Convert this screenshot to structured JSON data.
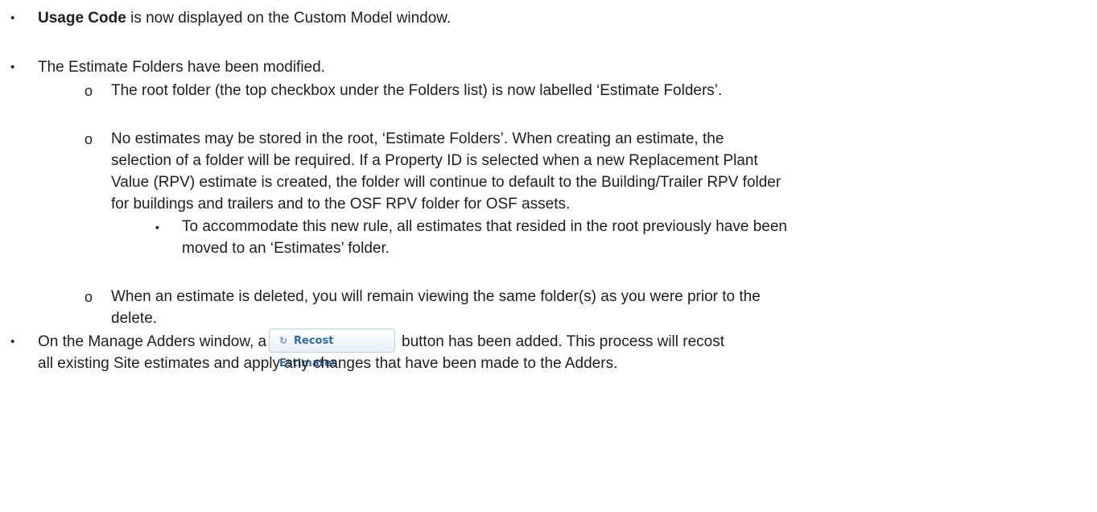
{
  "bullets": {
    "b1": {
      "bold": "Usage Code",
      "rest": " is now displayed on the Custom Model window."
    },
    "b2": {
      "text": "The Estimate Folders have been modified."
    },
    "sub1": {
      "text": "The root folder (the top checkbox under the Folders list) is now labelled ‘Estimate Folders’."
    },
    "sub2": {
      "lines": [
        "No estimates may be stored in the root, ‘Estimate Folders’.  When creating an estimate, the",
        "selection of a folder will be required.  If a Property ID is selected when a new Replacement Plant",
        "Value (RPV) estimate is created, the folder will continue to default to the Building/Trailer RPV folder",
        "for buildings and trailers and to the OSF RPV folder for OSF assets."
      ]
    },
    "sub2_1": {
      "lines": [
        "To accommodate this new rule, all estimates that resided in the root previously have been",
        "moved to an ‘Estimates’ folder."
      ]
    },
    "sub3": {
      "lines": [
        "When an estimate is deleted, you will remain viewing the same folder(s) as you were prior to the",
        "delete."
      ]
    },
    "b3": {
      "before": "On the Manage Adders window, a",
      "after": "button has been added.  This process will recost",
      "line2": "all existing Site estimates and apply any changes that have been made to the Adders."
    }
  },
  "recost_button": {
    "label": "Recost Estimates",
    "icon": "refresh-icon"
  },
  "glyphs": {
    "disc": "•",
    "circle": "o",
    "square": "▪"
  }
}
